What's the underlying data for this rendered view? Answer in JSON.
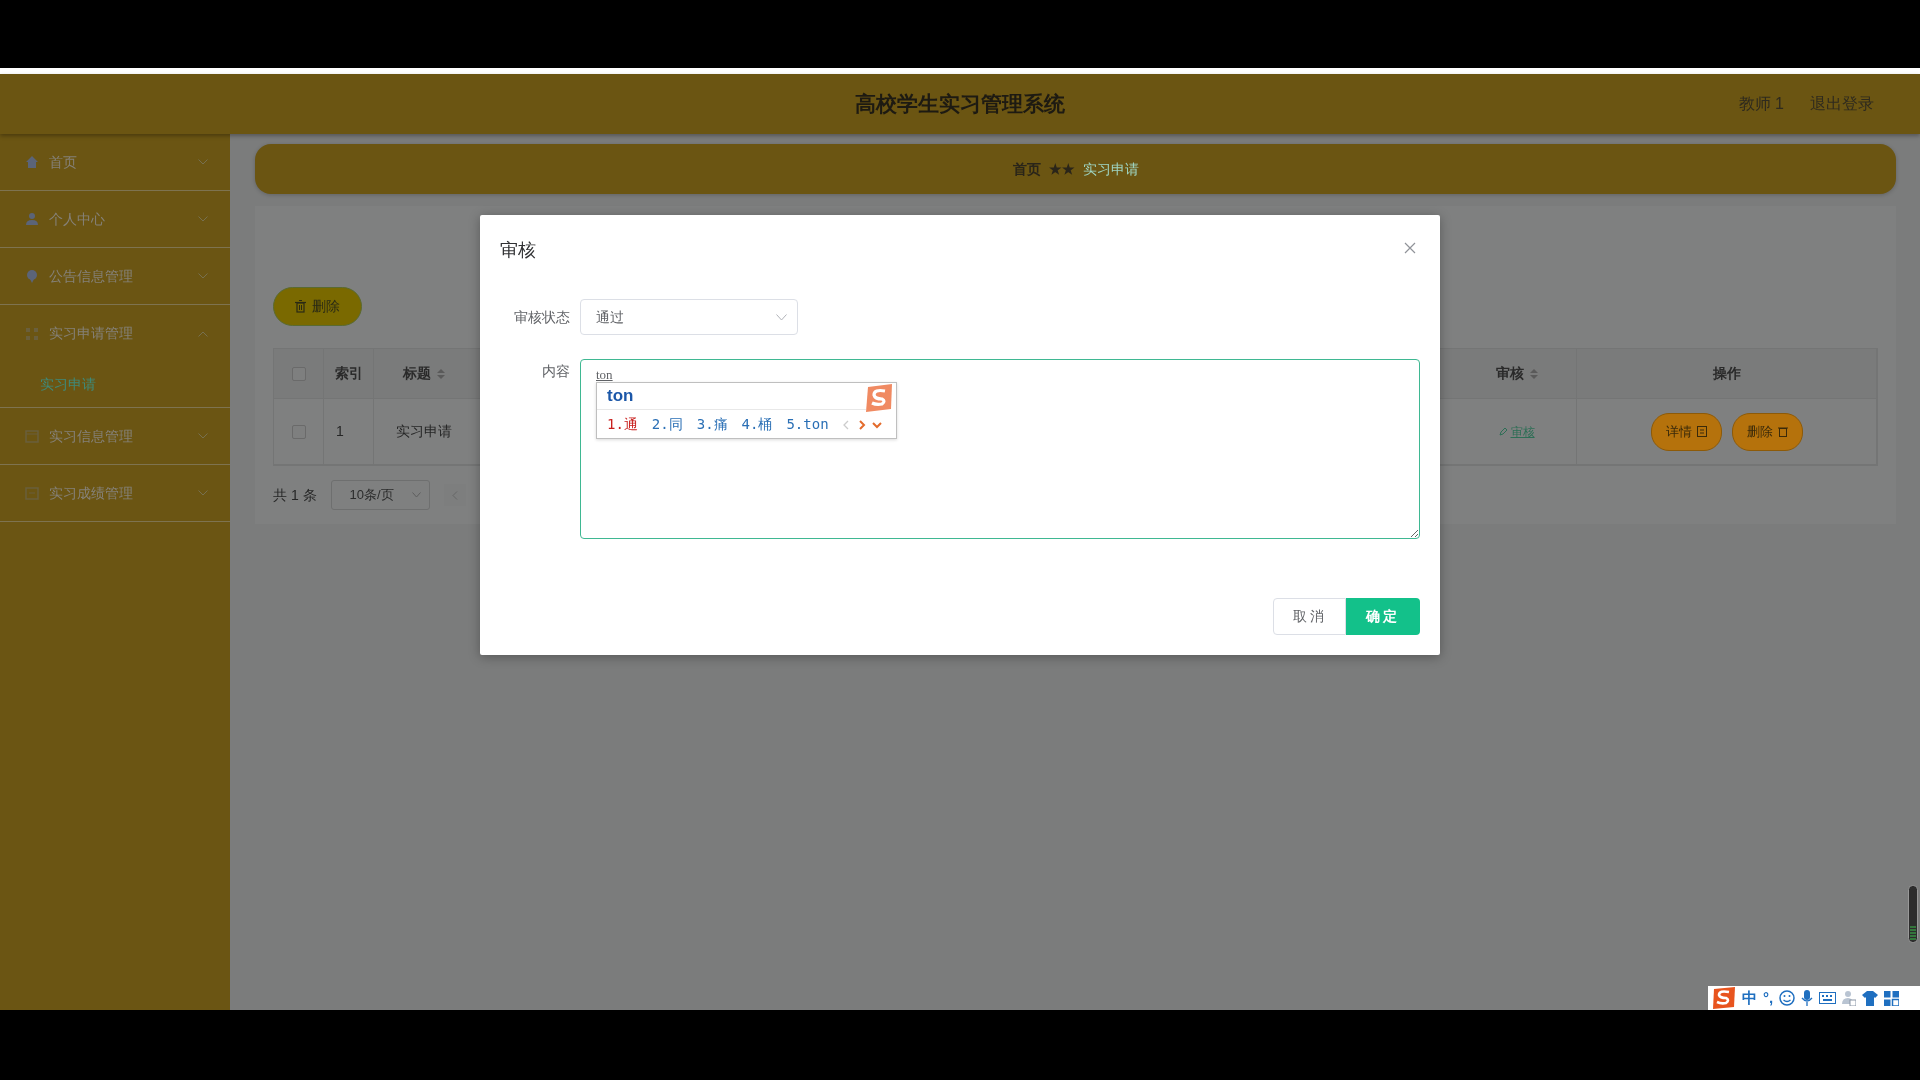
{
  "header": {
    "title": "高校学生实习管理系统",
    "user": "教师 1",
    "logout": "退出登录"
  },
  "sidebar": {
    "items": [
      {
        "label": "首页",
        "expanded": false
      },
      {
        "label": "个人中心",
        "expanded": false
      },
      {
        "label": "公告信息管理",
        "expanded": false
      },
      {
        "label": "实习申请管理",
        "expanded": true,
        "children": [
          {
            "label": "实习申请",
            "selected": true
          }
        ]
      },
      {
        "label": "实习信息管理",
        "expanded": false
      },
      {
        "label": "实习成绩管理",
        "expanded": false
      }
    ]
  },
  "breadcrumb": {
    "items": [
      "首页",
      "实习申请"
    ],
    "separator": "★★"
  },
  "toolbar": {
    "delete_button": "删除"
  },
  "table": {
    "all_checked": false,
    "columns": [
      {
        "kind": "checkbox"
      },
      {
        "label": "索引",
        "kind": "text",
        "sortable": false
      },
      {
        "label": "标题",
        "kind": "text",
        "sortable": true
      },
      {
        "label": "审核",
        "kind": "text",
        "sortable": true
      },
      {
        "label": "操作",
        "kind": "text",
        "sortable": false
      }
    ],
    "rows": [
      {
        "checked": false,
        "index": "1",
        "title": "实习申请",
        "review": "审核",
        "actions": [
          "详情",
          "删除"
        ]
      }
    ]
  },
  "pagination": {
    "total": "共 1 条",
    "page_size": "10条/页"
  },
  "modal": {
    "title": "审核",
    "status_label": "审核状态",
    "status_value": "通过",
    "content_label": "内容",
    "content_value": "ton",
    "cancel": "取消",
    "ok": "确定"
  },
  "ime_popup": {
    "composition": "ton",
    "candidates": [
      {
        "label": "1.通",
        "selected": true
      },
      {
        "label": "2.同",
        "selected": false
      },
      {
        "label": "3.痛",
        "selected": false
      },
      {
        "label": "4.桶",
        "selected": false
      },
      {
        "label": "5.ton",
        "selected": false
      }
    ]
  },
  "ime_toolbar": {
    "mode": "中",
    "punctuation": "°,"
  }
}
